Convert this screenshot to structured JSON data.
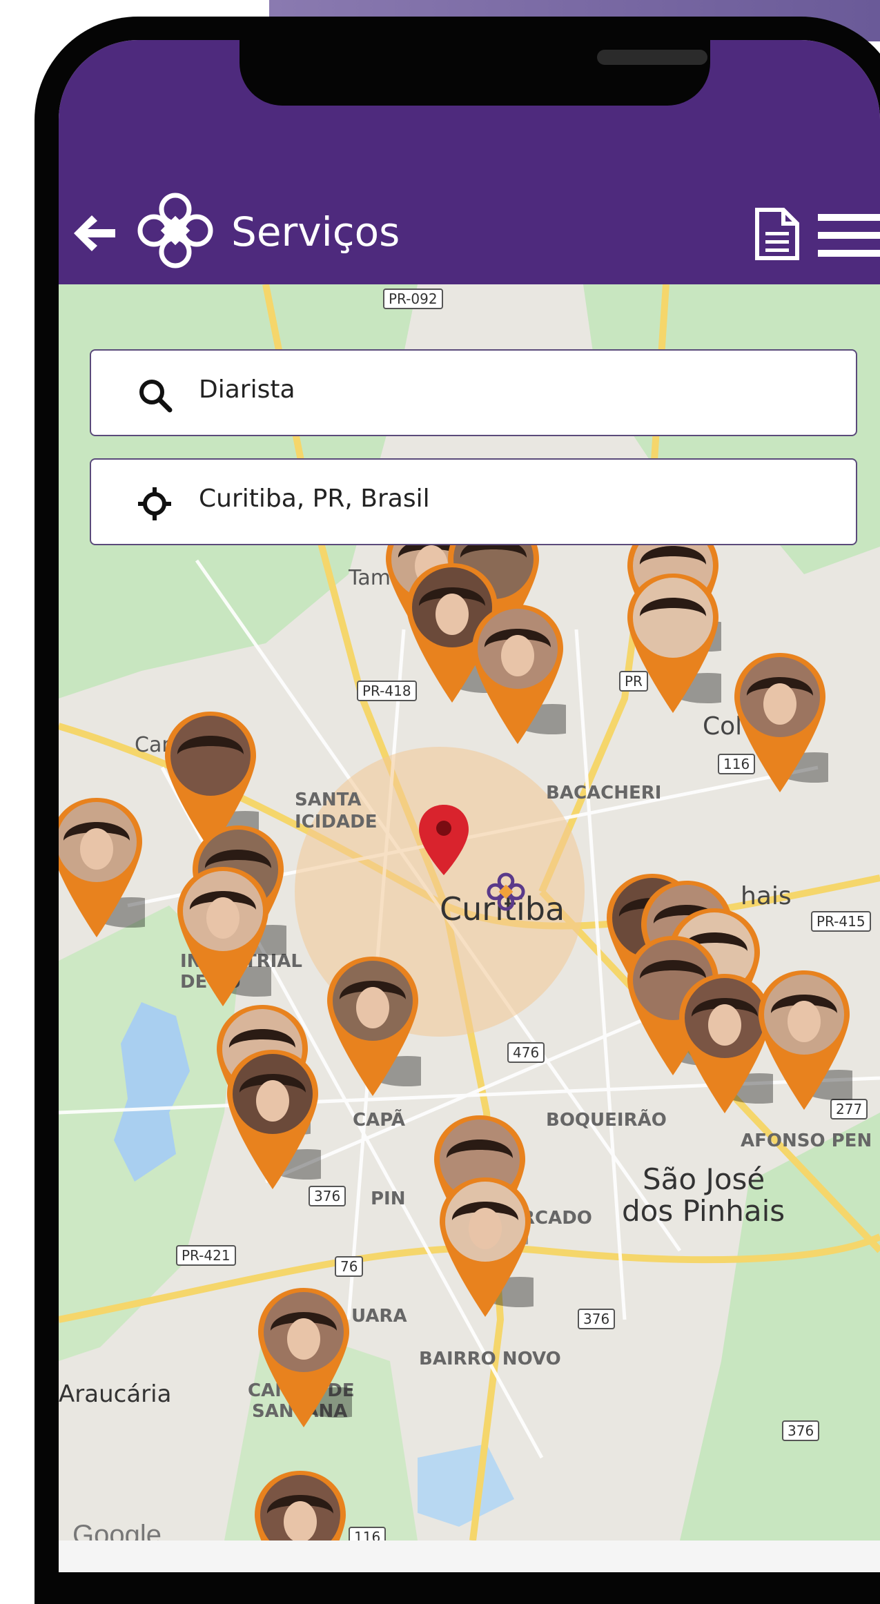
{
  "header": {
    "title": "Serviços",
    "back_icon": "arrow-left-icon",
    "logo_icon": "flower-logo-icon",
    "doc_icon": "document-icon",
    "menu_icon": "hamburger-menu-icon",
    "bg_color": "#4e2a7d"
  },
  "search": {
    "value": "Diarista",
    "icon": "search-icon"
  },
  "location": {
    "value": "Curitiba, PR, Brasil",
    "icon": "crosshair-icon"
  },
  "map": {
    "city": "Curitiba",
    "city2_line1": "São José",
    "city2_line2": "dos Pinhais",
    "labels": {
      "tama": "Tama",
      "cam": "Cam",
      "col": "Col",
      "hais": "hais",
      "araucaria": "Araucária",
      "santa_1": "SANTA",
      "santa_2": "ICIDADE",
      "bacacheri": "BACACHERI",
      "boqueirao": "BOQUEIRÃO",
      "afonso": "AFONSO PEN",
      "cic_1": "DE",
      "cic_2": "INDUSTRIAL",
      "cic_3": "DE CU",
      "capa": "CAPÃ",
      "pin": "PIN",
      "cercado": "O CERCADO",
      "bairro_novo": "BAIRRO NOVO",
      "campo_1": "CAMPO DE",
      "campo_2": "SANTANA",
      "uara": "UARA",
      "google": "Google"
    },
    "roads": {
      "pr092": "PR-092",
      "pr418": "PR-418",
      "pr": "PR",
      "r116a": "116",
      "r116b": "116",
      "pr415": "PR-415",
      "r476": "476",
      "r277": "277",
      "r376a": "376",
      "r376b": "376",
      "r376c": "376",
      "pr421": "PR-421",
      "r76": "76"
    },
    "pin_color": "#e8821e",
    "center_pin_color": "#d9232d",
    "radius_color": "#f2c896"
  }
}
